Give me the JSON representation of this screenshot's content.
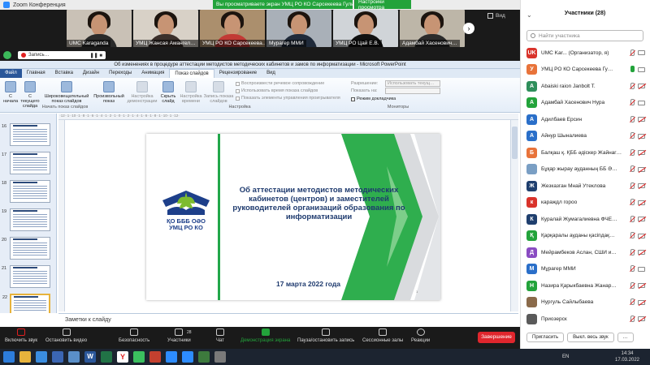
{
  "zoom": {
    "title": "Zoom Конференция",
    "share_banner": "Вы просматриваете экран УМЦ РО КО  Сарсекеева Гульмира…",
    "view_options": "Настройки просмотра",
    "video_label": "Вид",
    "tiles": [
      {
        "name": "UMC Karaganda",
        "shirt": "#2a2a2a",
        "bg": "#c9c1b6"
      },
      {
        "name": "УМЦ Жансая Амангел…",
        "shirt": "#3b2f2a",
        "bg": "#d8d1c7"
      },
      {
        "name": "УМЦ РО КО  Сарсекеева…",
        "shirt": "#c23a35",
        "bg": "#ab8f6d"
      },
      {
        "name": "Мурагер ММИ",
        "shirt": "#1f2a3a",
        "bg": "#a9b0b8"
      },
      {
        "name": "УМЦ РО Цай Е.В.",
        "shirt": "#111111",
        "bg": "#d0d4d8"
      },
      {
        "name": "Адамбай Хасенович…",
        "shirt": "#2b2b2b",
        "bg": "#bdb6a8"
      }
    ],
    "recording_label": "Запись…",
    "toolbar": {
      "mute": "Включить звук",
      "video": "Остановить видео",
      "security": "Безопасность",
      "participants": "Участники",
      "participants_count": "28",
      "chat": "Чат",
      "share": "Демонстрация экрана",
      "pause": "Пауза/остановить запись",
      "breakout": "Сессионные залы",
      "reactions": "Реакции",
      "end": "Завершение"
    }
  },
  "ppt": {
    "window_title": "Об изменениях в процедуре  аттестации методистов методических кабинетов и замов по информатизации - Microsoft PowerPoint",
    "tabs": [
      "Файл",
      "Главная",
      "Вставка",
      "Дизайн",
      "Переходы",
      "Анимация",
      "Показ слайдов",
      "Рецензирование",
      "Вид"
    ],
    "ribbon": {
      "from_start": "С начала",
      "from_current": "С текущего слайда",
      "broadcast": "Широковещательный показ слайдов",
      "custom": "Произвольный показ",
      "setup": "Настройка демонстрации",
      "hide": "Скрыть слайд",
      "rehearse": "Настройка времени",
      "record": "Запись показа слайдов",
      "group_start": "Начать показ слайдов",
      "group_setup": "Настройка",
      "group_monitors": "Мониторы",
      "chk_narration": "Воспроизвести речевое сопровождение",
      "chk_timing": "Использовать время показа слайдов",
      "chk_controls": "Показать элементы управления проигрывателя",
      "resolution_label": "Разрешение:",
      "resolution_value": "Использовать текущ…",
      "show_on_label": "Показать на:",
      "presenter_view": "Режим докладчика"
    },
    "thumb_numbers": [
      "16",
      "17",
      "18",
      "19",
      "20",
      "21",
      "22"
    ],
    "notes_placeholder": "Заметки к слайду"
  },
  "slide": {
    "logo_line1": "ҚО БББ ОӘО",
    "logo_line2": "УМЦ РО КО",
    "title": "Об аттестации методистов методических кабинетов (центров) и заместителей руководителей организаций образования по информатизации",
    "date": "17 марта 2022 года",
    "page": "1"
  },
  "participants": {
    "title": "Участники (28)",
    "search_placeholder": "Найти участника",
    "list": [
      {
        "initials": "UK",
        "name": "UMC Kar... (Организатор, я)",
        "color": "#d9332b",
        "mic": "off",
        "cam": "on"
      },
      {
        "initials": "У",
        "name": "УМЦ РО КО  Сарсекеева Гу…",
        "color": "#e8733a",
        "mic": "live",
        "cam": "on"
      },
      {
        "initials": "A",
        "name": "Abaiski raion Janbolt T.",
        "color": "#2f8f5b",
        "mic": "off",
        "cam": "off"
      },
      {
        "initials": "A",
        "name": "Адамбай Хасенович Нура",
        "color": "#23a33b",
        "mic": "off",
        "cam": "on"
      },
      {
        "initials": "А",
        "name": "Адилбаев Ерсин",
        "color": "#2a6fc9",
        "mic": "off",
        "cam": "off"
      },
      {
        "initials": "А",
        "name": "Айнур Шыналиева",
        "color": "#2a6fc9",
        "mic": "off",
        "cam": "off"
      },
      {
        "initials": "Б",
        "name": "Балқаш қ. ҚББ әдіскер Жайнаг…",
        "color": "#e8733a",
        "mic": "off",
        "cam": "off"
      },
      {
        "initials": "",
        "name": "Бұқар жырау ауданның ББ Ә…",
        "color": "#7a9fc4",
        "mic": "off",
        "cam": "off"
      },
      {
        "initials": "Ж",
        "name": "Жезказган Мнай Утеклова",
        "color": "#1f3f6e",
        "mic": "off",
        "cam": "off"
      },
      {
        "initials": "к",
        "name": "караждл горoo",
        "color": "#d9332b",
        "mic": "off",
        "cam": "off"
      },
      {
        "initials": "К",
        "name": "Куралай Жумагалиевна ФЧЕ…",
        "color": "#1f3f6e",
        "mic": "off",
        "cam": "off"
      },
      {
        "initials": "Қ",
        "name": "Қарқаралы ауданы қасіпдақ…",
        "color": "#23a33b",
        "mic": "off",
        "cam": "off"
      },
      {
        "initials": "Д",
        "name": "Мейрамбеков Аслан, СШИ и…",
        "color": "#8a4cc2",
        "mic": "off",
        "cam": "off"
      },
      {
        "initials": "M",
        "name": "Мұрагер ММИ",
        "color": "#2a6fc9",
        "mic": "off",
        "cam": "on"
      },
      {
        "initials": "Н",
        "name": "Назира Қарыкбаевна Жанар…",
        "color": "#23a33b",
        "mic": "off",
        "cam": "off"
      },
      {
        "initials": "",
        "name": "Нургуль Сайлыбаева",
        "color": "#8a6a4a",
        "mic": "off",
        "cam": "off"
      },
      {
        "initials": "",
        "name": "Приозерск",
        "color": "#5a5a5a",
        "mic": "off",
        "cam": "off"
      }
    ],
    "invite": "Пригласить",
    "mute_all": "Выкл. весь звук",
    "more": "…"
  },
  "taskbar": {
    "lang": "EN",
    "time": "14:34",
    "date": "17.03.2022"
  }
}
